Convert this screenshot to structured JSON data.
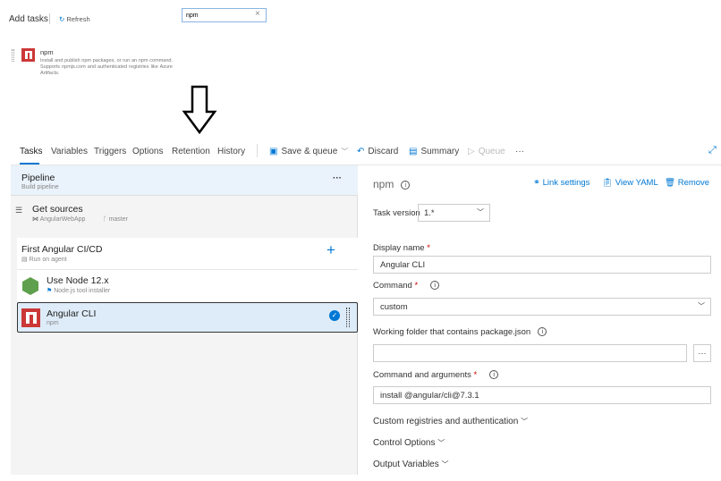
{
  "add_tasks": {
    "title": "Add tasks",
    "refresh": "Refresh",
    "search_value": "npm",
    "result": {
      "name": "npm",
      "description": "Install and publish npm packages, or run an npm command. Supports npmjs.com and authenticated registries like Azure Artifacts."
    }
  },
  "tabs": [
    "Tasks",
    "Variables",
    "Triggers",
    "Options",
    "Retention",
    "History"
  ],
  "toolbar": {
    "save": "Save & queue",
    "discard": "Discard",
    "summary": "Summary",
    "queue": "Queue",
    "more": "···"
  },
  "pipeline": {
    "title": "Pipeline",
    "subtitle": "Build pipeline",
    "more": "···",
    "sources": {
      "title": "Get sources",
      "repo": "AngularWebApp",
      "branch": "master"
    },
    "job": {
      "title": "First Angular CI/CD",
      "subtitle": "Run on agent",
      "add": "+"
    },
    "tasks": [
      {
        "name": "Use Node 12.x",
        "sub": "Node.js tool installer"
      },
      {
        "name": "Angular CLI",
        "sub": "npm"
      }
    ]
  },
  "detail": {
    "title": "npm",
    "link_settings": "Link settings",
    "view_yaml": "View YAML",
    "remove": "Remove",
    "task_version_label": "Task version",
    "task_version": "1.*",
    "display_name_label": "Display name",
    "display_name": "Angular CLI",
    "command_label": "Command",
    "command": "custom",
    "working_folder_label": "Working folder that contains package.json",
    "working_folder": "",
    "args_label": "Command and arguments",
    "args": "install @angular/cli@7.3.1",
    "sections": [
      "Custom registries and authentication",
      "Control Options",
      "Output Variables"
    ],
    "required": "*",
    "browse": "···"
  }
}
